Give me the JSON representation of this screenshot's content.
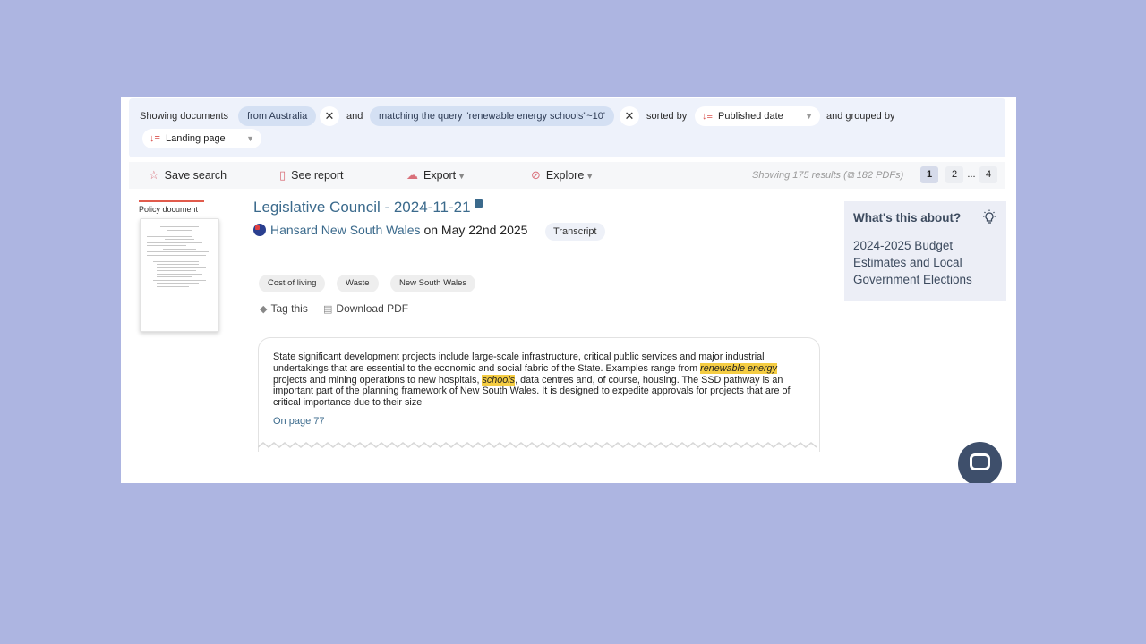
{
  "filter_bar": {
    "showing_label": "Showing documents",
    "chip_country": "from Australia",
    "and_label": "and",
    "chip_query": "matching the query \"renewable energy schools\"~10'",
    "sorted_label": "sorted by",
    "sort_value": "Published date",
    "grouped_label": "and grouped by",
    "group_value": "Landing page",
    "remove_glyph": "✕"
  },
  "toolbar": {
    "save_search": "Save search",
    "see_report": "See report",
    "export": "Export",
    "explore": "Explore",
    "results_text": "Showing 175 results (⧉ 182 PDFs)",
    "pages": [
      "1",
      "2",
      "...",
      "4"
    ],
    "active_page": "1"
  },
  "result": {
    "doc_type": "Policy document",
    "title": "Legislative Council - 2024-11-21",
    "source_name": "Hansard New South Wales",
    "source_date": " on May 22nd 2025",
    "badge": "Transcript",
    "tags": [
      "Cost of living",
      "Waste",
      "New South Wales"
    ],
    "tag_this": "Tag this",
    "download_pdf": "Download PDF",
    "excerpt": {
      "part1": "State significant development projects include large-scale infrastructure, critical public services and major industrial undertakings that are essential to the economic and social fabric of the State. Examples range from ",
      "hl1": "renewable energy",
      "part2": " projects and mining operations to new hospitals, ",
      "hl2": "schools",
      "part3": ", data centres and, of course, housing. The SSD pathway is an important part of the planning framework of New South Wales. It is designed to expedite approvals for projects that are of critical importance due to their size",
      "page": "On page 77"
    }
  },
  "about": {
    "title": "What's this about?",
    "body": "2024-2025 Budget Estimates and Local Government Elections"
  },
  "colors": {
    "background": "#adb5e1",
    "link": "#3b6a8c",
    "highlight": "#f5cd43",
    "accent": "#e15b4c"
  }
}
